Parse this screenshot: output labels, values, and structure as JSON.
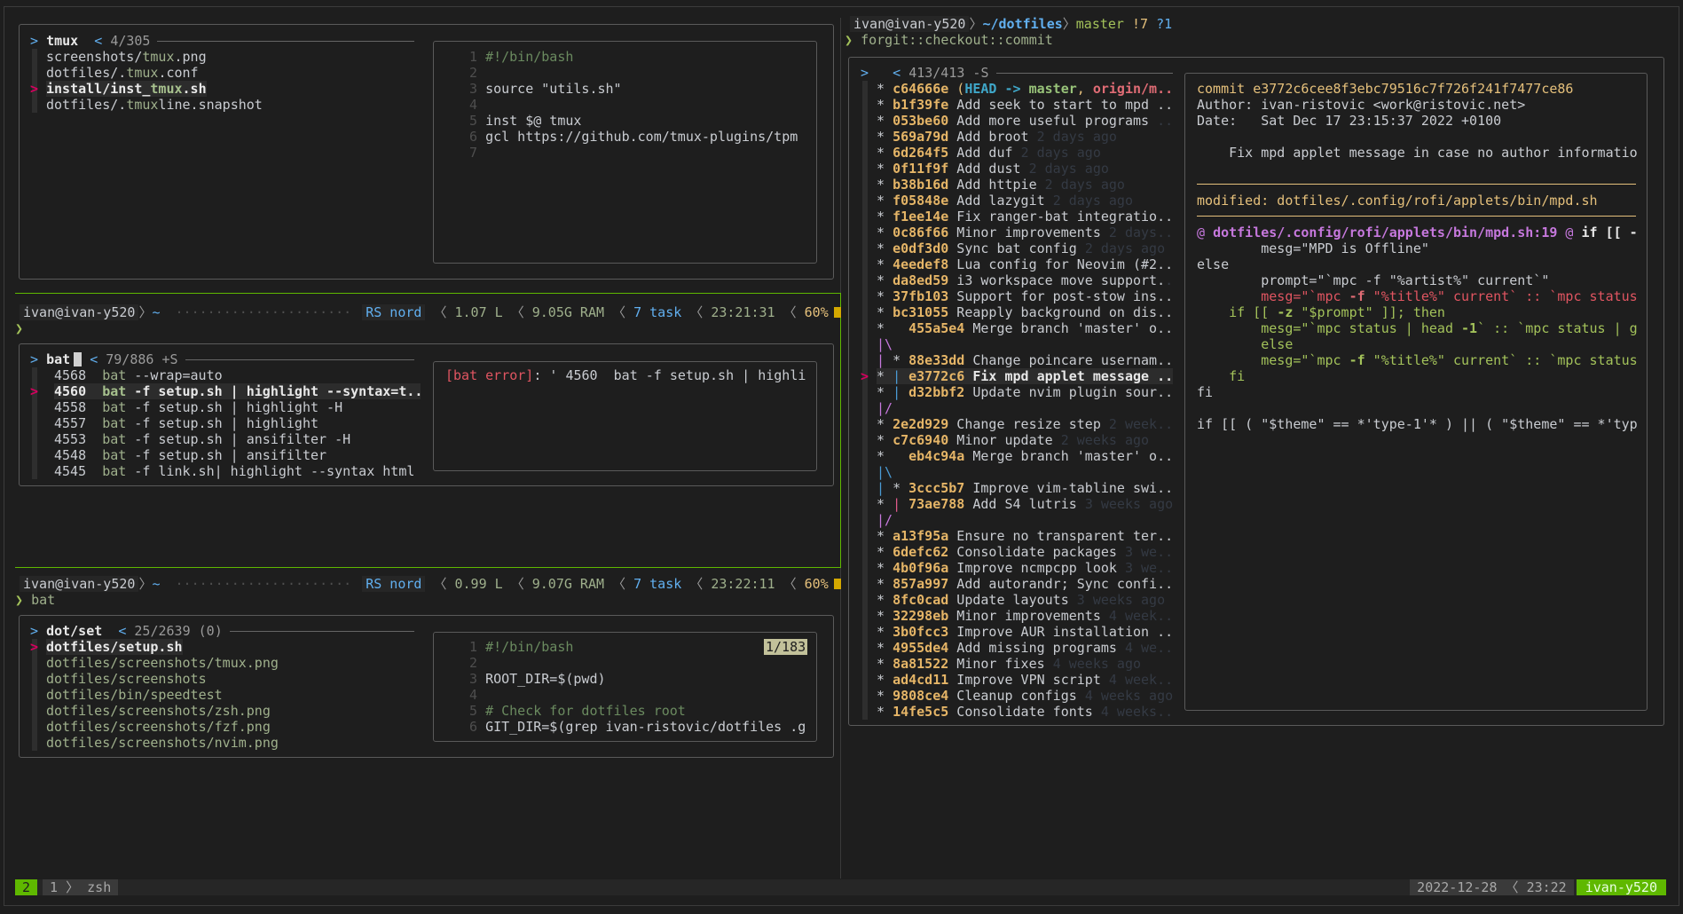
{
  "colors": {
    "bg": "#1e1e1e",
    "active_border": "#5fb800",
    "hash": "#e5b567",
    "pointer": "#d7005f",
    "status_green": "#5fb800"
  },
  "tmux_finder": {
    "header": {
      "prompt": ">",
      "query": "tmux",
      "count_marker": "<",
      "count": "4/305"
    },
    "pointer": ">",
    "selected": 2,
    "items": [
      [
        [
          "screenshots/",
          "n"
        ],
        [
          "tmux",
          "m"
        ],
        [
          ".png",
          "n"
        ]
      ],
      [
        [
          "dotfiles/.",
          "n"
        ],
        [
          "tmux",
          "m"
        ],
        [
          ".conf",
          "n"
        ]
      ],
      [
        [
          "install/inst_",
          "b"
        ],
        [
          "tmux",
          "mb"
        ],
        [
          ".sh",
          "b"
        ]
      ],
      [
        [
          "dotfiles/.",
          "n"
        ],
        [
          "tmux",
          "m"
        ],
        [
          "line.snapshot",
          "n"
        ]
      ]
    ],
    "preview": [
      [
        [
          "1 ",
          "ln"
        ],
        [
          "#!/bin/bash",
          "cm"
        ]
      ],
      [
        [
          "2 ",
          "ln"
        ]
      ],
      [
        [
          "3 ",
          "ln"
        ],
        [
          "source \"utils.sh\"",
          "n"
        ]
      ],
      [
        [
          "4 ",
          "ln"
        ]
      ],
      [
        [
          "5 ",
          "ln"
        ],
        [
          "inst $@ tmux",
          "n"
        ]
      ],
      [
        [
          "6 ",
          "ln"
        ],
        [
          "gcl https://github.com/tmux-plugins/tpm",
          "n"
        ]
      ],
      [
        [
          "7 ",
          "ln"
        ]
      ]
    ]
  },
  "prompt1": {
    "user": "ivan@ivan-y520",
    "sep": "〉",
    "dir": "~",
    "dots": "······················",
    "vcs": "RS nord",
    "load": "1.07 L",
    "ram": "9.05G RAM",
    "tasks": "7 task",
    "time": "23:21:31",
    "battery": "60%",
    "caret": "❯",
    "command": ""
  },
  "bat_finder": {
    "header": {
      "prompt": ">",
      "query": "bat",
      "count_marker": "<",
      "count": "79/886 +S"
    },
    "pointer": ">",
    "selected": 1,
    "items": [
      [
        [
          "4568  ",
          "n"
        ],
        [
          "bat",
          "m"
        ],
        [
          " --wrap=auto",
          "n"
        ]
      ],
      [
        [
          "4560  ",
          "b"
        ],
        [
          "bat",
          "mb"
        ],
        [
          " -f setup.sh | highlight --syntax=t..",
          "b"
        ]
      ],
      [
        [
          "4558  ",
          "n"
        ],
        [
          "bat",
          "m"
        ],
        [
          " -f setup.sh | highlight -H",
          "n"
        ]
      ],
      [
        [
          "4557  ",
          "n"
        ],
        [
          "bat",
          "m"
        ],
        [
          " -f setup.sh | highlight",
          "n"
        ]
      ],
      [
        [
          "4553  ",
          "n"
        ],
        [
          "bat",
          "m"
        ],
        [
          " -f setup.sh | ansifilter -H",
          "n"
        ]
      ],
      [
        [
          "4548  ",
          "n"
        ],
        [
          "bat",
          "m"
        ],
        [
          " -f setup.sh | ansifilter",
          "n"
        ]
      ],
      [
        [
          "4545  ",
          "n"
        ],
        [
          "bat",
          "m"
        ],
        [
          " -f link.sh| highlight --syntax html",
          "n"
        ]
      ]
    ],
    "preview": [
      [
        [
          "[bat error]",
          "rd"
        ],
        [
          ": ' 4560  bat -f setup.sh | highli",
          "n"
        ]
      ]
    ]
  },
  "prompt2": {
    "user": "ivan@ivan-y520",
    "sep": "〉",
    "dir": "~",
    "dots": "······················",
    "vcs": "RS nord",
    "load": "0.99 L",
    "ram": "9.07G RAM",
    "tasks": "7 task",
    "time": "23:22:11",
    "battery": "60%",
    "caret": "❯",
    "command": "bat"
  },
  "dot_finder": {
    "header": {
      "prompt": ">",
      "query": "dot/set",
      "count_marker": "<",
      "count": "25/2639 (0)"
    },
    "pointer": ">",
    "selected": 0,
    "scroll_badge": "1/183",
    "items": [
      [
        [
          "dotfiles/setup.sh",
          "b"
        ]
      ],
      [
        [
          "dotfiles/screenshots/tmux.png",
          "m"
        ]
      ],
      [
        [
          "dotfiles/screenshots",
          "m"
        ]
      ],
      [
        [
          "dotfiles/bin/speedtest",
          "m"
        ]
      ],
      [
        [
          "dotfiles/screenshots/zsh.png",
          "m"
        ]
      ],
      [
        [
          "dotfiles/screenshots/fzf.png",
          "m"
        ]
      ],
      [
        [
          "dotfiles/screenshots/nvim.png",
          "m"
        ]
      ]
    ],
    "preview": [
      [
        [
          "1 ",
          "ln"
        ],
        [
          "#!/bin/bash",
          "cm"
        ]
      ],
      [
        [
          "2 ",
          "ln"
        ]
      ],
      [
        [
          "3 ",
          "ln"
        ],
        [
          "ROOT_DIR=$(pwd)",
          "n"
        ]
      ],
      [
        [
          "4 ",
          "ln"
        ]
      ],
      [
        [
          "5 ",
          "ln"
        ],
        [
          "# Check for dotfiles root",
          "cm"
        ]
      ],
      [
        [
          "6 ",
          "ln"
        ],
        [
          "GIT_DIR=$(grep ivan-ristovic/dotfiles .g",
          "n"
        ]
      ]
    ]
  },
  "right_prompt": {
    "user": "ivan@ivan-y520",
    "sep": "〉",
    "dir": "~/dotfiles",
    "branch": "master",
    "status": "!7",
    "untracked": "?1",
    "caret": "❯",
    "command": "forgit::checkout::commit"
  },
  "commits": {
    "header": {
      "prompt": ">",
      "count_marker": "<",
      "count": "413/413 -S"
    },
    "pointer": ">",
    "selected": 18,
    "items": [
      [
        [
          "* ",
          "n"
        ],
        [
          "c64666e",
          "h"
        ],
        [
          " (",
          "y"
        ],
        [
          "HEAD ->",
          "cyb"
        ],
        [
          " master",
          "grb"
        ],
        [
          ", ",
          "y"
        ],
        [
          "origin/m..",
          "rdb"
        ]
      ],
      [
        [
          "* ",
          "n"
        ],
        [
          "b1f39fe",
          "h"
        ],
        [
          " Add seek to start to mpd ..",
          "n"
        ]
      ],
      [
        [
          "* ",
          "n"
        ],
        [
          "053be60",
          "h"
        ],
        [
          " Add more useful programs ",
          "n"
        ],
        [
          "..",
          "d"
        ]
      ],
      [
        [
          "* ",
          "n"
        ],
        [
          "569a79d",
          "h"
        ],
        [
          " Add broot ",
          "n"
        ],
        [
          "2 days ago",
          "d"
        ]
      ],
      [
        [
          "* ",
          "n"
        ],
        [
          "6d264f5",
          "h"
        ],
        [
          " Add duf ",
          "n"
        ],
        [
          "2 days ago",
          "d"
        ]
      ],
      [
        [
          "* ",
          "n"
        ],
        [
          "0f11f9f",
          "h"
        ],
        [
          " Add dust ",
          "n"
        ],
        [
          "2 days ago",
          "d"
        ]
      ],
      [
        [
          "* ",
          "n"
        ],
        [
          "b38b16d",
          "h"
        ],
        [
          " Add httpie ",
          "n"
        ],
        [
          "2 days ago",
          "d"
        ]
      ],
      [
        [
          "* ",
          "n"
        ],
        [
          "f05848e",
          "h"
        ],
        [
          " Add lazygit ",
          "n"
        ],
        [
          "2 days ago",
          "d"
        ]
      ],
      [
        [
          "* ",
          "n"
        ],
        [
          "f1ee14e",
          "h"
        ],
        [
          " Fix ranger-bat integratio..",
          "n"
        ]
      ],
      [
        [
          "* ",
          "n"
        ],
        [
          "0c86f66",
          "h"
        ],
        [
          " Minor improvements ",
          "n"
        ],
        [
          "2 days..",
          "d"
        ]
      ],
      [
        [
          "* ",
          "n"
        ],
        [
          "e0df3d0",
          "h"
        ],
        [
          " Sync bat config ",
          "n"
        ],
        [
          "2 days ago",
          "d"
        ]
      ],
      [
        [
          "* ",
          "n"
        ],
        [
          "4eedef8",
          "h"
        ],
        [
          " Lua config for Neovim (#2..",
          "n"
        ]
      ],
      [
        [
          "* ",
          "n"
        ],
        [
          "da8ed59",
          "h"
        ],
        [
          " i3 workspace move support.",
          "n"
        ],
        [
          ".",
          "d"
        ]
      ],
      [
        [
          "* ",
          "n"
        ],
        [
          "37fb103",
          "h"
        ],
        [
          " Support for post-stow ins..",
          "n"
        ]
      ],
      [
        [
          "* ",
          "n"
        ],
        [
          "bc31055",
          "h"
        ],
        [
          " Reapply background on dis..",
          "n"
        ]
      ],
      [
        [
          "*   ",
          "n"
        ],
        [
          "455a5e4",
          "h"
        ],
        [
          " Merge branch 'master' o..",
          "n"
        ]
      ],
      [
        [
          "|\\",
          "pu"
        ]
      ],
      [
        [
          "| ",
          "pu"
        ],
        [
          "* ",
          "n"
        ],
        [
          "88e33dd",
          "h"
        ],
        [
          " Change poincare usernam..",
          "n"
        ]
      ],
      [
        [
          "* ",
          "n"
        ],
        [
          "| ",
          "gb"
        ],
        [
          "e3772c6",
          "h"
        ],
        [
          " Fix mpd applet message ..",
          "b"
        ]
      ],
      [
        [
          "* ",
          "n"
        ],
        [
          "| ",
          "gb"
        ],
        [
          "d32bbf2",
          "h"
        ],
        [
          " Update nvim plugin sour..",
          "n"
        ]
      ],
      [
        [
          "|/",
          "pu"
        ]
      ],
      [
        [
          "* ",
          "n"
        ],
        [
          "2e2d929",
          "h"
        ],
        [
          " Change resize step ",
          "n"
        ],
        [
          "2 week..",
          "d"
        ]
      ],
      [
        [
          "* ",
          "n"
        ],
        [
          "c7c6940",
          "h"
        ],
        [
          " Minor update ",
          "n"
        ],
        [
          "2 weeks ago",
          "d"
        ]
      ],
      [
        [
          "*   ",
          "n"
        ],
        [
          "eb4c94a",
          "h"
        ],
        [
          " Merge branch 'master' o..",
          "n"
        ]
      ],
      [
        [
          "|\\",
          "gb"
        ]
      ],
      [
        [
          "| ",
          "gb"
        ],
        [
          "* ",
          "n"
        ],
        [
          "3ccc5b7",
          "h"
        ],
        [
          " Improve vim-tabline swi..",
          "n"
        ]
      ],
      [
        [
          "* ",
          "n"
        ],
        [
          "| ",
          "pk"
        ],
        [
          "73ae788",
          "h"
        ],
        [
          " Add S4 lutris ",
          "n"
        ],
        [
          "3 weeks ago",
          "d"
        ]
      ],
      [
        [
          "|/",
          "pu"
        ]
      ],
      [
        [
          "* ",
          "n"
        ],
        [
          "a13f95a",
          "h"
        ],
        [
          " Ensure no transparent ter..",
          "n"
        ]
      ],
      [
        [
          "* ",
          "n"
        ],
        [
          "6defc62",
          "h"
        ],
        [
          " Consolidate packages ",
          "n"
        ],
        [
          "3 we..",
          "d"
        ]
      ],
      [
        [
          "* ",
          "n"
        ],
        [
          "4b0f96a",
          "h"
        ],
        [
          " Improve ncmpcpp look ",
          "n"
        ],
        [
          "3 we..",
          "d"
        ]
      ],
      [
        [
          "* ",
          "n"
        ],
        [
          "857a997",
          "h"
        ],
        [
          " Add autorandr; Sync confi..",
          "n"
        ]
      ],
      [
        [
          "* ",
          "n"
        ],
        [
          "8fc0cad",
          "h"
        ],
        [
          " Update layouts ",
          "n"
        ],
        [
          "3 weeks ago",
          "d"
        ]
      ],
      [
        [
          "* ",
          "n"
        ],
        [
          "32298eb",
          "h"
        ],
        [
          " Minor improvements ",
          "n"
        ],
        [
          "4 week..",
          "d"
        ]
      ],
      [
        [
          "* ",
          "n"
        ],
        [
          "3b0fcc3",
          "h"
        ],
        [
          " Improve AUR installation ..",
          "n"
        ]
      ],
      [
        [
          "* ",
          "n"
        ],
        [
          "4955de4",
          "h"
        ],
        [
          " Add missing programs ",
          "n"
        ],
        [
          "4 we..",
          "d"
        ]
      ],
      [
        [
          "* ",
          "n"
        ],
        [
          "8a81522",
          "h"
        ],
        [
          " Minor fixes ",
          "n"
        ],
        [
          "4 weeks ago",
          "d"
        ]
      ],
      [
        [
          "* ",
          "n"
        ],
        [
          "ad4cd11",
          "h"
        ],
        [
          " Improve VPN script ",
          "n"
        ],
        [
          "4 week..",
          "d"
        ]
      ],
      [
        [
          "* ",
          "n"
        ],
        [
          "9808ce4",
          "h"
        ],
        [
          " Cleanup configs ",
          "n"
        ],
        [
          "4 weeks ago",
          "d"
        ]
      ],
      [
        [
          "* ",
          "n"
        ],
        [
          "14fe5c5",
          "h"
        ],
        [
          " Consolidate fonts ",
          "n"
        ],
        [
          "4 weeks..",
          "d"
        ]
      ]
    ],
    "preview": [
      [
        [
          "commit e3772c6cee8f3ebc79516c7f726f241f7477ce86",
          "y"
        ]
      ],
      [
        [
          "Author: ivan-ristovic <work@ristovic.net>",
          "n"
        ]
      ],
      [
        [
          "Date:   Sat Dec 17 23:15:37 2022 +0100",
          "n"
        ]
      ],
      [],
      [
        [
          "    Fix mpd applet message in case no author informatio",
          "n"
        ]
      ],
      [],
      [],
      [
        [
          "modified: dotfiles/.config/rofi/applets/bin/mpd.sh",
          "y"
        ]
      ],
      [],
      [
        [
          "@ ",
          "pu"
        ],
        [
          "dotfiles/.config/rofi/applets/bin/mpd.sh:19",
          "pub"
        ],
        [
          " @ ",
          "pu"
        ],
        [
          "if [[ -",
          "b"
        ]
      ],
      [
        [
          "        mesg=\"MPD is Offline\"",
          "n"
        ]
      ],
      [
        [
          "else",
          "n"
        ]
      ],
      [
        [
          "        prompt=\"`mpc -f \"%artist%\" current`\"",
          "n"
        ]
      ],
      [
        [
          "        mesg=\"`mpc ",
          "rd"
        ],
        [
          "-f",
          "rdb"
        ],
        [
          " \"%title%\" current` :: `mpc status",
          "rd"
        ]
      ],
      [
        [
          "    if [[ ",
          "ok"
        ],
        [
          "-z",
          "okb"
        ],
        [
          " \"$prompt\" ]]; then",
          "ok"
        ]
      ],
      [
        [
          "        mesg=\"`mpc status | head ",
          "ok"
        ],
        [
          "-1",
          "okb"
        ],
        [
          "` :: `mpc status | g",
          "ok"
        ]
      ],
      [
        [
          "        else",
          "ok"
        ]
      ],
      [
        [
          "        mesg=\"`mpc ",
          "ok"
        ],
        [
          "-f",
          "okb"
        ],
        [
          " \"%title%\" current` :: `mpc status",
          "ok"
        ]
      ],
      [
        [
          "    fi",
          "ok"
        ]
      ],
      [
        [
          "fi",
          "n"
        ]
      ],
      [],
      [
        [
          "if [[ ( \"$theme\" == *'type-1'* ) || ( \"$theme\" == *'typ",
          "n"
        ]
      ]
    ]
  },
  "statusbar": {
    "session": "2",
    "window_index": "1",
    "window_sep": "〉",
    "window_name": "zsh",
    "date": "2022-12-28",
    "date_sep": "〈",
    "time": "23:22",
    "host": "ivan-y520"
  }
}
